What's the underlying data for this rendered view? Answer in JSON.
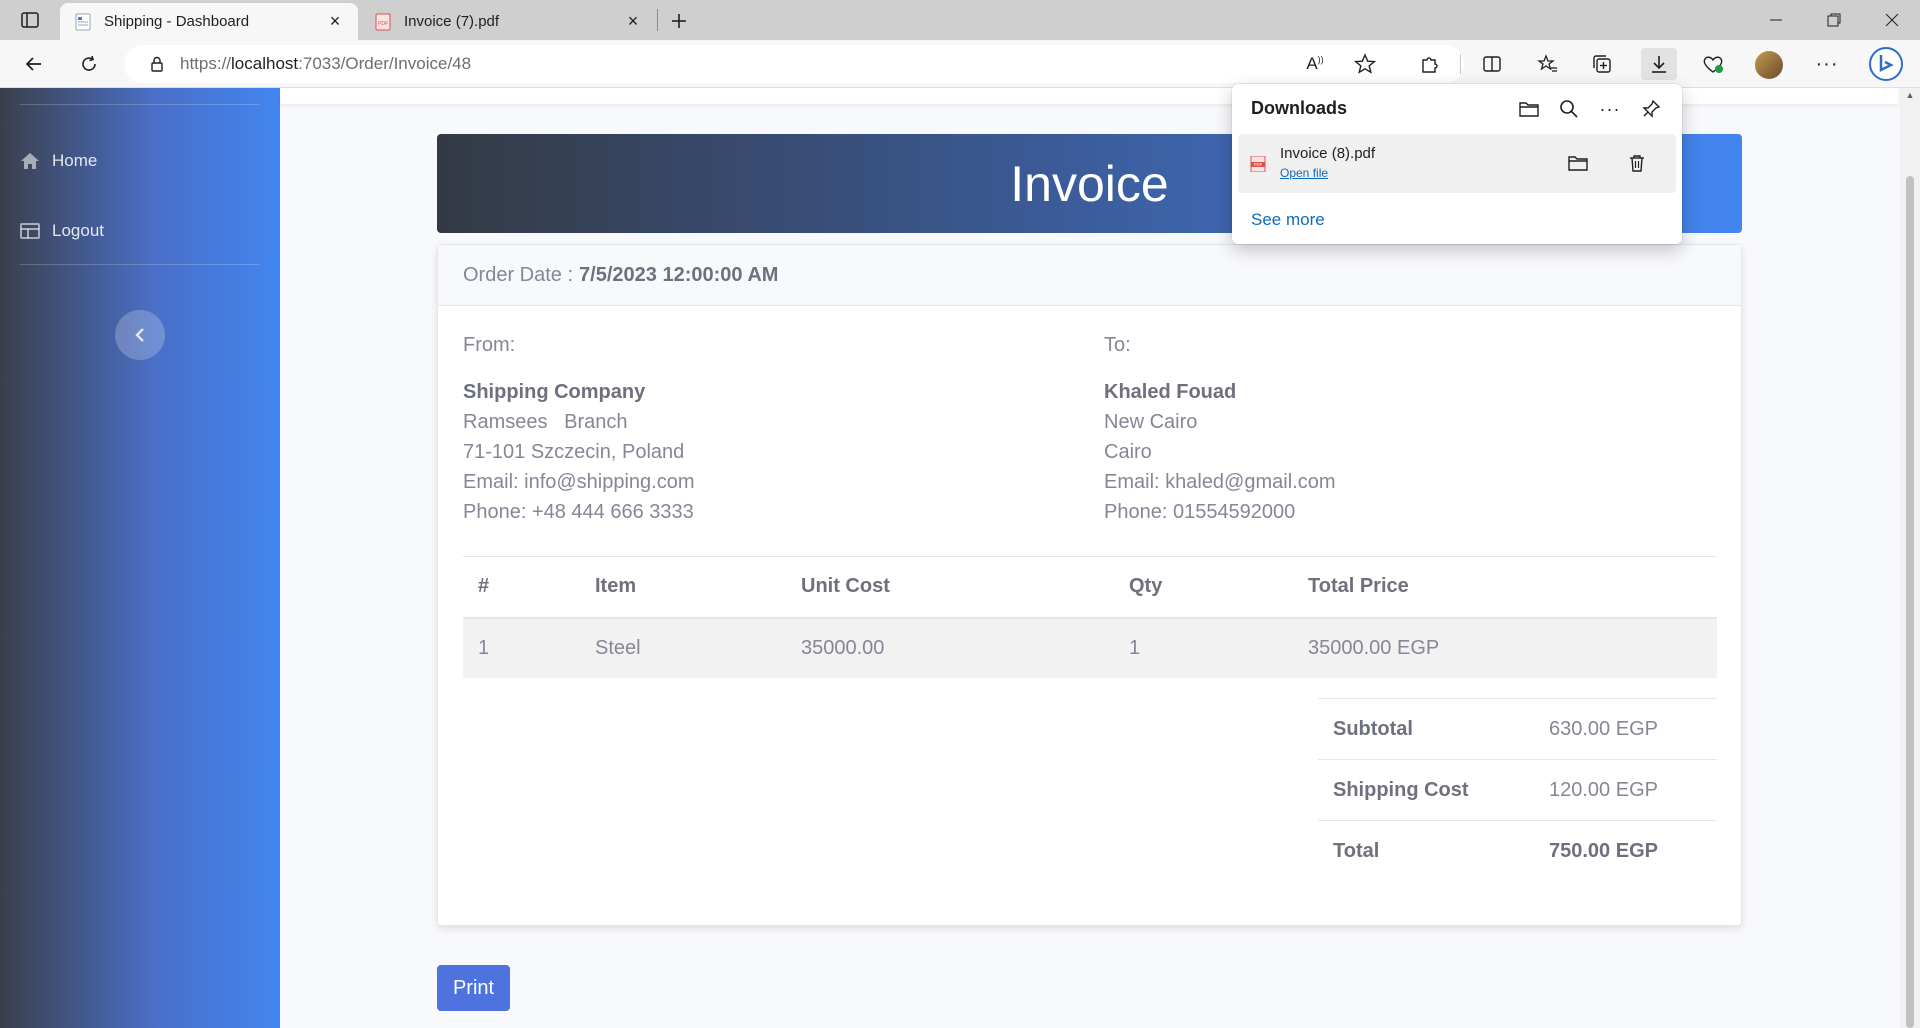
{
  "browser": {
    "tabs": [
      {
        "title": "Shipping - Dashboard",
        "active": true
      },
      {
        "title": "Invoice (7).pdf",
        "active": false
      }
    ],
    "url": {
      "prefix": "https://",
      "host": "localhost",
      "rest": ":7033/Order/Invoice/48"
    }
  },
  "downloads": {
    "title": "Downloads",
    "item": {
      "file": "Invoice (8).pdf",
      "open_label": "Open file"
    },
    "see_more": "See more"
  },
  "sidebar": {
    "items": [
      {
        "label": "Home",
        "icon": "home-icon"
      },
      {
        "label": "Logout",
        "icon": "table-icon"
      }
    ]
  },
  "invoice": {
    "title": "Invoice",
    "order_date_label": "Order Date :",
    "order_date": "7/5/2023 12:00:00 AM",
    "from": {
      "label": "From:",
      "name": "Shipping Company",
      "line1": "Ramsees   Branch",
      "line2": "71-101 Szczecin, Poland",
      "email": "Email: info@shipping.com",
      "phone": "Phone: +48 444 666 3333"
    },
    "to": {
      "label": "To:",
      "name": "Khaled Fouad",
      "line1": "New Cairo",
      "line2": "Cairo",
      "email": "Email: khaled@gmail.com",
      "phone": "Phone: 01554592000"
    },
    "table": {
      "headers": [
        "#",
        "Item",
        "Unit Cost",
        "Qty",
        "Total Price"
      ],
      "rows": [
        [
          "1",
          "Steel",
          "35000.00",
          "1",
          "35000.00 EGP"
        ]
      ]
    },
    "totals": [
      {
        "label": "Subtotal",
        "value": "630.00 EGP"
      },
      {
        "label": "Shipping Cost",
        "value": "120.00 EGP"
      },
      {
        "label": "Total",
        "value": "750.00 EGP"
      }
    ],
    "print_label": "Print"
  },
  "colors": {
    "primary": "#4e73df",
    "text": "#858796",
    "link": "#0f6cbd"
  }
}
